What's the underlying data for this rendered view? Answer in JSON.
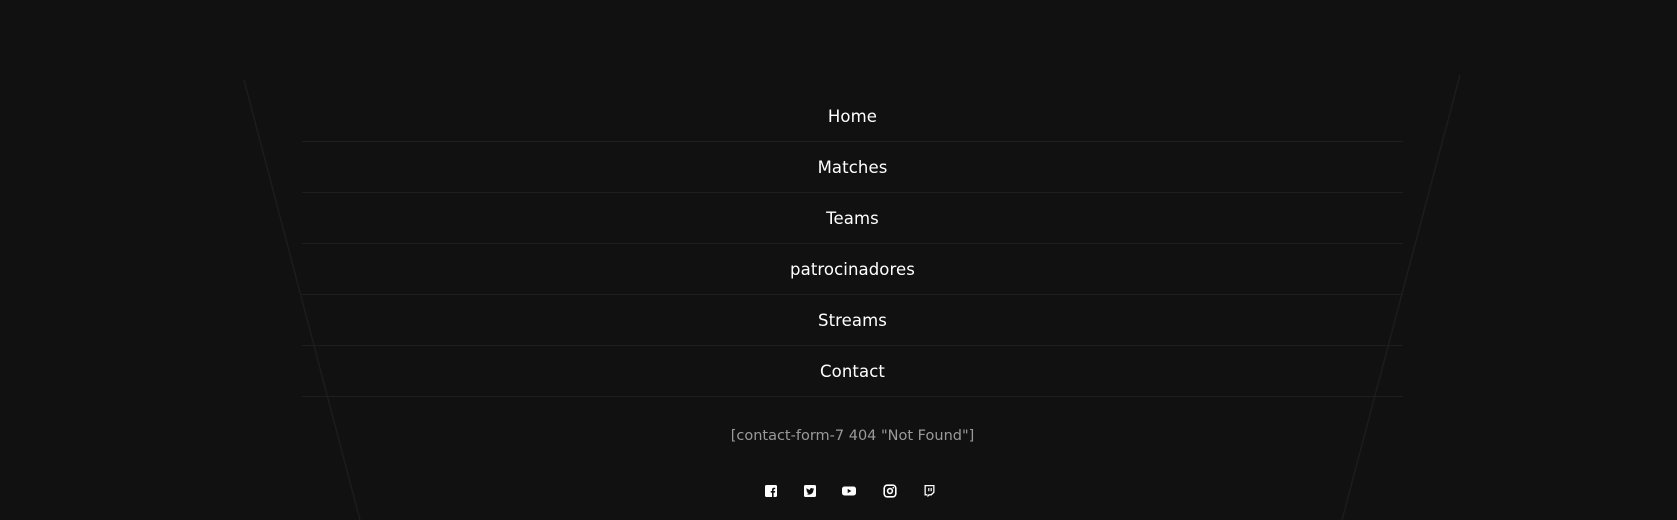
{
  "nav": {
    "items": [
      {
        "label": "Home"
      },
      {
        "label": "Matches"
      },
      {
        "label": "Teams"
      },
      {
        "label": "patrocinadores"
      },
      {
        "label": "Streams"
      },
      {
        "label": "Contact"
      }
    ]
  },
  "contact": {
    "shortcode_text": "[contact-form-7 404 \"Not Found\"]"
  },
  "social": {
    "icons": [
      "facebook-icon",
      "twitter-icon",
      "youtube-icon",
      "instagram-icon",
      "twitch-icon"
    ]
  },
  "colors": {
    "background": "#111111",
    "divider": "#1e1e1e",
    "text": "#ffffff",
    "muted_text": "#9a9a9a"
  }
}
